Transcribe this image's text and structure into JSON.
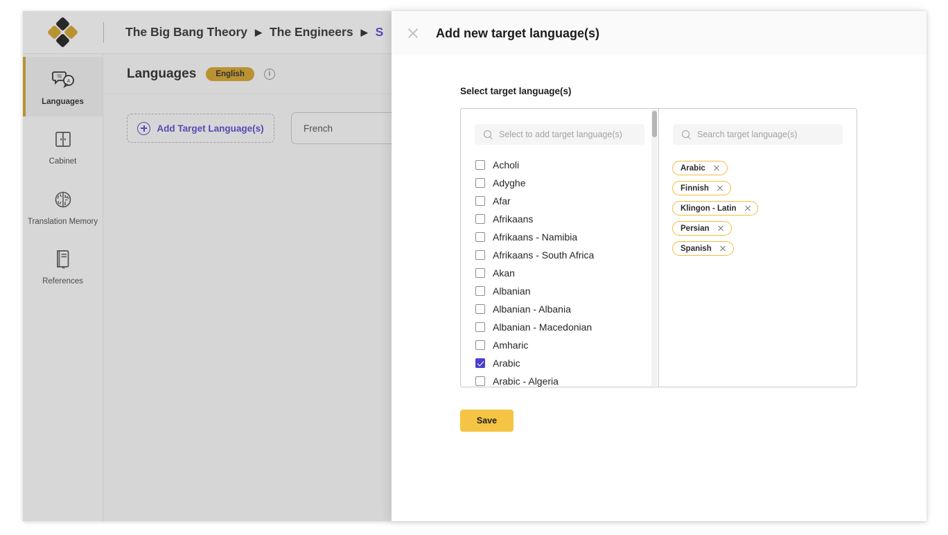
{
  "app": {
    "logo_name": "diamond-logo"
  },
  "breadcrumb": {
    "items": [
      {
        "label": "The Big Bang Theory",
        "active": false
      },
      {
        "label": "The Engineers",
        "active": false
      },
      {
        "label": "S",
        "active": true
      }
    ],
    "separator": "▶"
  },
  "sidebar": {
    "items": [
      {
        "label": "Languages",
        "icon": "translate-bubbles-icon",
        "active": true
      },
      {
        "label": "Cabinet",
        "icon": "cabinet-icon",
        "active": false
      },
      {
        "label": "Translation Memory",
        "icon": "brain-icon",
        "active": false
      },
      {
        "label": "References",
        "icon": "book-icon",
        "active": false
      }
    ]
  },
  "page": {
    "title": "Languages",
    "source_badge": "English",
    "info_icon_char": "i",
    "add_button_label": "Add Target Language(s)",
    "target_card_label": "French"
  },
  "modal": {
    "title": "Add new target language(s)",
    "close_icon": "close-icon",
    "section_label": "Select target language(s)",
    "left_panel": {
      "search_placeholder": "Select to add target language(s)",
      "options": [
        {
          "label": "Acholi",
          "checked": false
        },
        {
          "label": "Adyghe",
          "checked": false
        },
        {
          "label": "Afar",
          "checked": false
        },
        {
          "label": "Afrikaans",
          "checked": false
        },
        {
          "label": "Afrikaans - Namibia",
          "checked": false
        },
        {
          "label": "Afrikaans - South Africa",
          "checked": false
        },
        {
          "label": "Akan",
          "checked": false
        },
        {
          "label": "Albanian",
          "checked": false
        },
        {
          "label": "Albanian - Albania",
          "checked": false
        },
        {
          "label": "Albanian - Macedonian",
          "checked": false
        },
        {
          "label": "Amharic",
          "checked": false
        },
        {
          "label": "Arabic",
          "checked": true
        },
        {
          "label": "Arabic - Algeria",
          "checked": false
        }
      ]
    },
    "right_panel": {
      "search_placeholder": "Search target language(s)",
      "chips": [
        {
          "label": "Arabic"
        },
        {
          "label": "Finnish"
        },
        {
          "label": "Klingon - Latin"
        },
        {
          "label": "Persian"
        },
        {
          "label": "Spanish"
        }
      ]
    },
    "save_label": "Save"
  },
  "colors": {
    "accent_gold": "#d4a01e",
    "button_gold": "#f6c445",
    "chip_border": "#f2bc3f",
    "link_purple": "#4b3fd0",
    "checkbox_checked": "#4b3fd0"
  }
}
